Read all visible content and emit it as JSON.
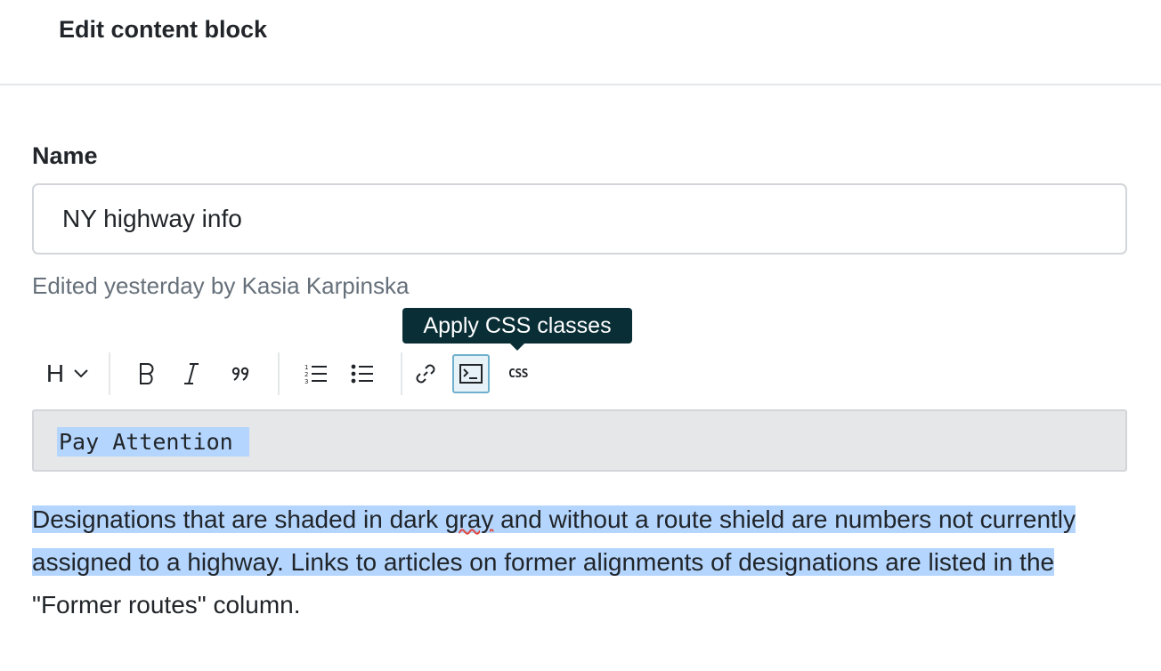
{
  "header": {
    "title": "Edit content block"
  },
  "form": {
    "name_label": "Name",
    "name_value": "NY highway info",
    "meta": "Edited yesterday by Kasia Karpinska"
  },
  "tooltip": {
    "text": "Apply CSS classes"
  },
  "toolbar": {
    "heading_label": "H",
    "css_label": "CSS",
    "items": [
      {
        "icon": "heading-dropdown-icon"
      },
      {
        "icon": "bold-icon"
      },
      {
        "icon": "italic-icon"
      },
      {
        "icon": "blockquote-icon"
      },
      {
        "icon": "ordered-list-icon"
      },
      {
        "icon": "bulleted-list-icon"
      },
      {
        "icon": "link-icon"
      },
      {
        "icon": "code-block-icon",
        "active": true
      },
      {
        "icon": "css-classes-icon"
      }
    ]
  },
  "editor": {
    "code_text": "Pay Attention",
    "para_part1": "Designations that are shaded in dark ",
    "para_misspelled": "gray",
    "para_part2": " and without a route shield are numbers not currently assigned to a highway. Links to articles on former alignments of designations are listed in the",
    "para_part3": " \"Former routes\" column."
  },
  "colors": {
    "tooltip_bg": "#0a2e36",
    "selection": "#b4d5fe",
    "active_button_border": "#6fb0cc",
    "code_bg": "#e6e7e9"
  }
}
